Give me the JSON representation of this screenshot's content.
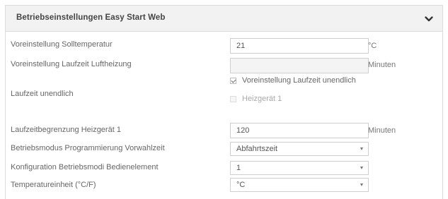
{
  "panel": {
    "title": "Betriebseinstellungen Easy Start Web"
  },
  "rows": {
    "solltemperatur": {
      "label": "Voreinstellung Solltemperatur",
      "value": "21",
      "unit": "°C"
    },
    "laufzeit_luftheizung": {
      "label": "Voreinstellung Laufzeit Luftheizung",
      "value": "",
      "unit": "Minuten"
    },
    "laufzeit_unendlich": {
      "label": "Laufzeit unendlich",
      "option_voreinstellung": {
        "label": "Voreinstellung Laufzeit unendlich",
        "checked": true
      },
      "option_heizgeraet": {
        "label": "Heizgerät 1",
        "checked": false
      }
    },
    "laufzeitbegrenzung": {
      "label": "Laufzeitbegrenzung Heizgerät 1",
      "value": "120",
      "unit": "Minuten"
    },
    "betriebsmodus": {
      "label": "Betriebsmodus Programmierung Vorwahlzeit",
      "selected": "Abfahrtszeit"
    },
    "konfiguration": {
      "label": "Konfiguration Betriebsmodi Bedienelement",
      "selected": "1"
    },
    "temperatureinheit": {
      "label": "Temperatureinheit (°C/F)",
      "selected": "°C"
    }
  },
  "icons": {
    "collapse": "chevron-down-icon",
    "dropdown": "caret-down-icon",
    "checkbox": "checkbox-icon"
  },
  "colors": {
    "header_bg": "#f2f2f2",
    "border": "#dcdcdc",
    "text": "#666666"
  }
}
